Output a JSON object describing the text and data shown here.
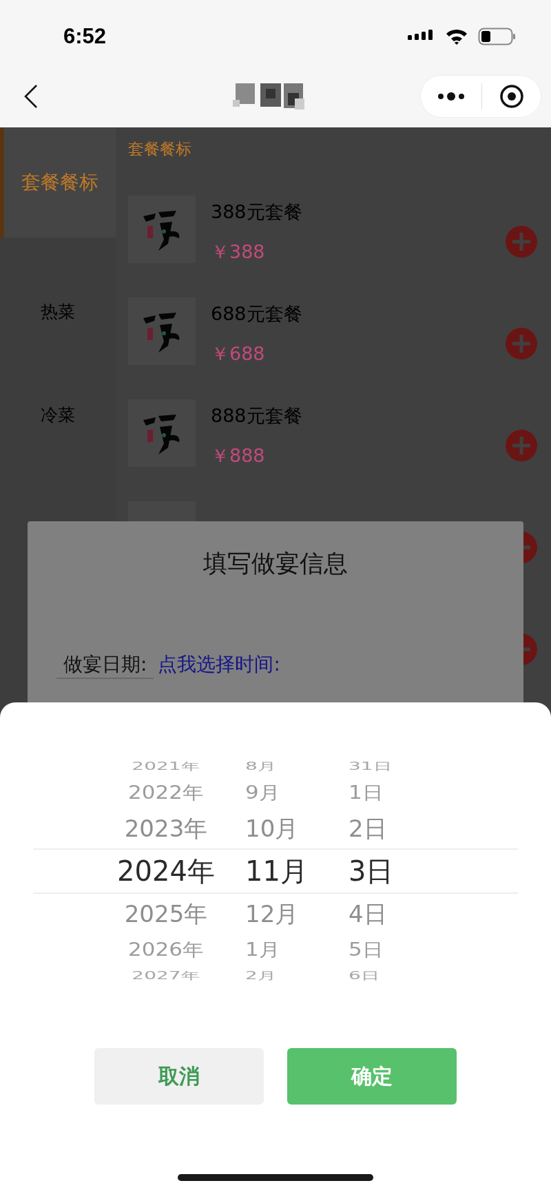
{
  "status_bar": {
    "time": "6:52"
  },
  "sidebar": {
    "items": [
      {
        "label": "套餐餐标",
        "selected": true
      },
      {
        "label": "热菜",
        "selected": false
      },
      {
        "label": "冷菜",
        "selected": false
      }
    ]
  },
  "section_title": "套餐餐标",
  "products": [
    {
      "kind": "full",
      "name": "388元套餐",
      "price": "￥388"
    },
    {
      "kind": "full",
      "name": "688元套餐",
      "price": "￥688"
    },
    {
      "kind": "full",
      "name": "888元套餐",
      "price": "￥888"
    },
    {
      "kind": "partial"
    },
    {
      "kind": "hidden"
    }
  ],
  "dialog": {
    "title": "填写做宴信息",
    "date_label": "做宴日期:",
    "date_link": "点我选择时间:"
  },
  "picker": {
    "columns": [
      {
        "options": [
          {
            "label": "2021年",
            "selected": false
          },
          {
            "label": "2022年",
            "selected": false
          },
          {
            "label": "2023年",
            "selected": false
          },
          {
            "label": "2024年",
            "selected": true
          },
          {
            "label": "2025年",
            "selected": false
          },
          {
            "label": "2026年",
            "selected": false
          },
          {
            "label": "2027年",
            "selected": false
          }
        ]
      },
      {
        "options": [
          {
            "label": "8月",
            "selected": false
          },
          {
            "label": "9月",
            "selected": false
          },
          {
            "label": "10月",
            "selected": false
          },
          {
            "label": "11月",
            "selected": true
          },
          {
            "label": "12月",
            "selected": false
          },
          {
            "label": "1月",
            "selected": false
          },
          {
            "label": "2月",
            "selected": false
          }
        ]
      },
      {
        "options": [
          {
            "label": "31日",
            "selected": false
          },
          {
            "label": "1日",
            "selected": false
          },
          {
            "label": "2日",
            "selected": false
          },
          {
            "label": "3日",
            "selected": true
          },
          {
            "label": "4日",
            "selected": false
          },
          {
            "label": "5日",
            "selected": false
          },
          {
            "label": "6日",
            "selected": false
          }
        ]
      }
    ],
    "cancel": "取消",
    "confirm": "确定"
  }
}
